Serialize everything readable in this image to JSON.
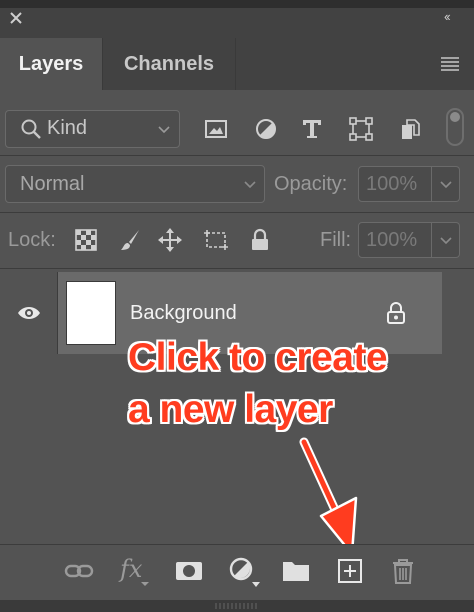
{
  "window": {
    "collapse_glyph": "‹‹"
  },
  "tabs": [
    {
      "label": "Layers",
      "active": true
    },
    {
      "label": "Channels",
      "active": false
    }
  ],
  "filter": {
    "kind_label": "Kind",
    "icons": [
      "image-filter-icon",
      "adjustment-filter-icon",
      "type-filter-icon",
      "shape-filter-icon",
      "smart-object-filter-icon"
    ]
  },
  "blend": {
    "mode": "Normal",
    "opacity_label": "Opacity:",
    "opacity_value": "100%"
  },
  "lock": {
    "label": "Lock:",
    "fill_label": "Fill:",
    "fill_value": "100%",
    "icons": [
      "lock-transparent-pixels-icon",
      "lock-image-pixels-icon",
      "lock-position-icon",
      "lock-artboard-icon",
      "lock-all-icon"
    ]
  },
  "layers": [
    {
      "name": "Background",
      "visible": true,
      "locked": true
    }
  ],
  "annotation": {
    "line1": "Click to create",
    "line2": "a new layer",
    "color": "#ff3c1f"
  },
  "bottom_toolbar": {
    "fx_label": "fx",
    "icons": [
      "link-layers-icon",
      "fx-icon",
      "add-mask-icon",
      "adjustment-layer-icon",
      "new-group-icon",
      "new-layer-icon",
      "delete-layer-icon"
    ]
  }
}
